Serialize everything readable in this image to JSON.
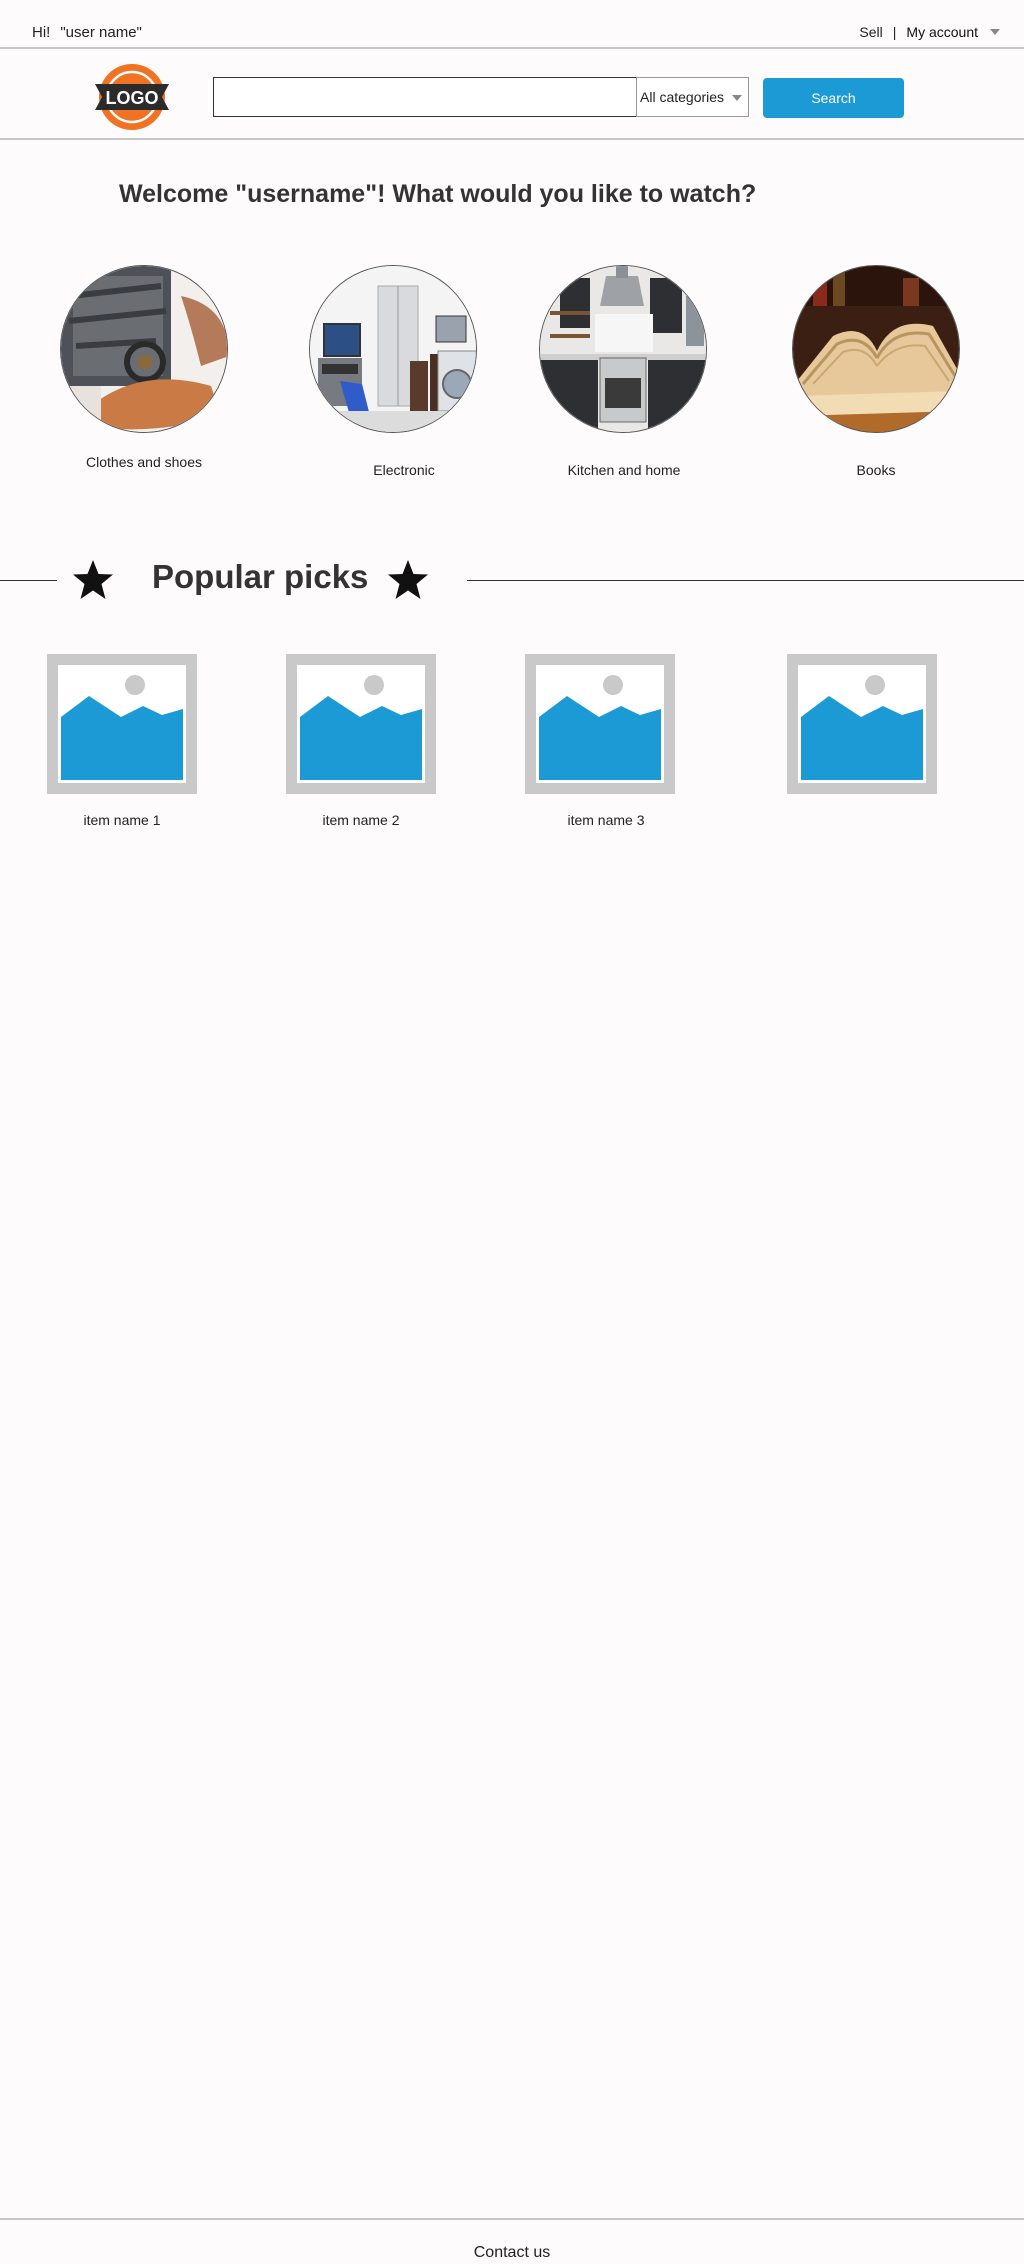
{
  "topbar": {
    "greeting": "Hi!",
    "username": "\"user name\"",
    "sell_label": "Sell",
    "separator": "|",
    "account_label": "My account"
  },
  "header": {
    "logo_text": "LOGO",
    "search_value": "",
    "category_selected": "All categories",
    "search_button": "Search"
  },
  "welcome": "Welcome \"username\"! What would you like to watch?",
  "categories": [
    {
      "label": "Clothes and shoes"
    },
    {
      "label": "Electronic"
    },
    {
      "label": "Kitchen and home"
    },
    {
      "label": "Books"
    }
  ],
  "popular": {
    "title": "Popular picks",
    "items": [
      {
        "label": "item name 1"
      },
      {
        "label": "item name 2"
      },
      {
        "label": "item name 3"
      },
      {
        "label": ""
      }
    ]
  },
  "footer": {
    "contact": "Contact us"
  },
  "colors": {
    "accent": "#1b9ad6",
    "logo_orange": "#f07323",
    "placeholder_frame": "#c9c9c9"
  }
}
